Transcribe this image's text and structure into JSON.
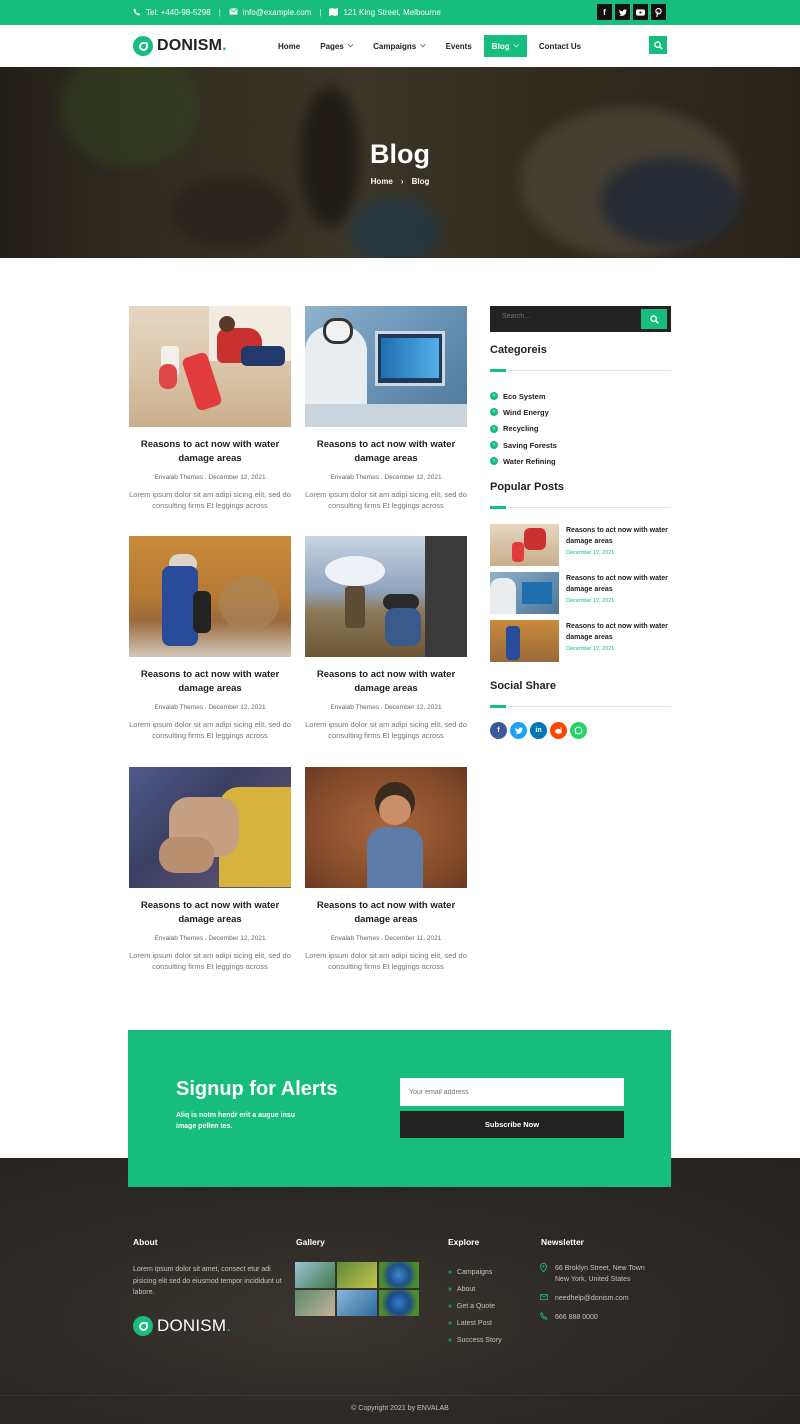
{
  "topbar": {
    "phone": "Tel: +440-98-5298",
    "email": "info@example.com",
    "address": "121 King Street, Melbourne",
    "socials": [
      "f",
      "t",
      "yt",
      "p"
    ]
  },
  "brand": {
    "name": "DONISM",
    "dot": "."
  },
  "nav": {
    "items": [
      "Home",
      "Pages",
      "Campaigns",
      "Events",
      "Blog",
      "Contact Us"
    ]
  },
  "hero": {
    "title": "Blog",
    "crumb_home": "Home",
    "crumb_current": "Blog"
  },
  "posts": [
    {
      "title": "Reasons to act now with water damage areas",
      "meta": "Envalab Themes . December 12, 2021",
      "excerpt": "Lorem ipsum dolor sit am adipi sicing elit, sed do consulting firms Et leggings across"
    },
    {
      "title": "Reasons to act now with water damage areas",
      "meta": "Envalab Themes . December 12, 2021",
      "excerpt": "Lorem ipsum dolor sit am adipi sicing elit, sed do consulting firms Et leggings across"
    },
    {
      "title": "Reasons to act now with water damage areas",
      "meta": "Envalab Themes . December 12, 2021",
      "excerpt": "Lorem ipsum dolor sit am adipi sicing elit, sed do consulting firms Et leggings across"
    },
    {
      "title": "Reasons to act now with water damage areas",
      "meta": "Envalab Themes . December 12, 2021",
      "excerpt": "Lorem ipsum dolor sit am adipi sicing elit, sed do consulting firms Et leggings across"
    },
    {
      "title": "Reasons to act now with water damage areas",
      "meta": "Envalab Themes . December 12, 2021",
      "excerpt": "Lorem ipsum dolor sit am adipi sicing elit, sed do consulting firms Et leggings across"
    },
    {
      "title": "Reasons to act now with water damage areas",
      "meta": "Envalab Themes . December 11, 2021",
      "excerpt": "Lorem ipsum dolor sit am adipi sicing elit, sed do consulting firms Et leggings across"
    }
  ],
  "sidebar": {
    "search_placeholder": "Search...",
    "categories_title": "Categoreis",
    "categories": [
      "Eco System",
      "Wind Energy",
      "Recycling",
      "Saving Forests",
      "Water Refining"
    ],
    "popular_title": "Popular Posts",
    "popular": [
      {
        "title": "Reasons to act now with water damage areas",
        "date": "December 12, 2021"
      },
      {
        "title": "Reasons to act now with water damage areas",
        "date": "December 12, 2021"
      },
      {
        "title": "Reasons to act now with water damage areas",
        "date": "December 12, 2021"
      }
    ],
    "social_title": "Social Share",
    "share_icons": [
      "facebook-icon",
      "twitter-icon",
      "linkedin-icon",
      "reddit-icon",
      "whatsapp-icon"
    ]
  },
  "alerts": {
    "title": "Signup for Alerts",
    "subtitle": "Aliq is notm hendr erit a augue insu image pellen tes.",
    "placeholder": "Your email address",
    "button": "Subscribe Now"
  },
  "footer": {
    "about_title": "About",
    "about_text": "Lorem ipsum dolor sit amet, consect etur adi pisicing elit sed do eiusmod tempor incididunt ut labore.",
    "gallery_title": "Gallery",
    "explore_title": "Explore",
    "explore": [
      "Campaigns",
      "About",
      "Get a Quote",
      "Latest Post",
      "Success Story"
    ],
    "newsletter_title": "Newsletter",
    "address": "66 Broklyn Street, New Town New York, United States",
    "email": "needhelp@donism.com",
    "phone": "666 888 0000",
    "copyright": "© Copyright 2021 by ENVALAB"
  },
  "colors": {
    "accent": "#16bd7c",
    "dark": "#222222"
  }
}
